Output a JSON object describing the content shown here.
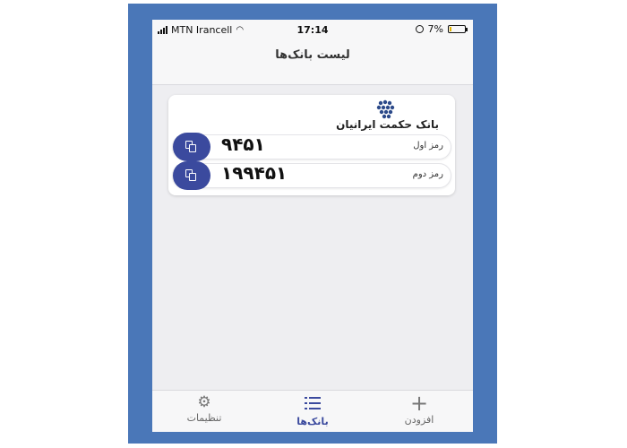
{
  "status_bar": {
    "carrier": "MTN Irancell",
    "time": "17:14",
    "battery": "7%"
  },
  "navbar": {
    "title": "لیست بانک‌ها"
  },
  "bank_card": {
    "bank_name": "بانک حکمت ایرانیان",
    "passwords": [
      {
        "label": "رمز اول",
        "value": "۹۴۵۱"
      },
      {
        "label": "رمز دوم",
        "value": "۱۹۹۴۵۱"
      }
    ]
  },
  "tabbar": {
    "items": [
      {
        "label": "تنظیمات",
        "icon": "gear-icon"
      },
      {
        "label": "بانک‌ها",
        "icon": "list-icon"
      },
      {
        "label": "افزودن",
        "icon": "plus-icon"
      }
    ]
  },
  "colors": {
    "frame": "#4a77b8",
    "accent": "#3b4a9e",
    "background": "#eeeef1",
    "battery_low": "#e2b400"
  }
}
